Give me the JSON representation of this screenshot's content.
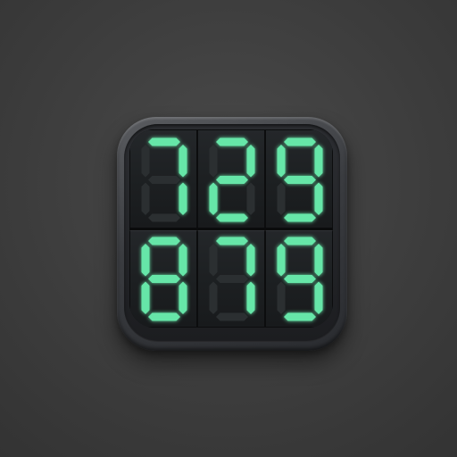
{
  "colors": {
    "segment_on": "#66e6a8",
    "segment_glow": "#3fd98f",
    "segment_off": "#2b2f31",
    "icon_frame": "#4a4c50",
    "screen": "#161819",
    "background": "#3d3d3d"
  },
  "display": {
    "rows": [
      {
        "digits": [
          "7",
          "2",
          "9"
        ]
      },
      {
        "digits": [
          "8",
          "7",
          "9"
        ]
      }
    ]
  }
}
